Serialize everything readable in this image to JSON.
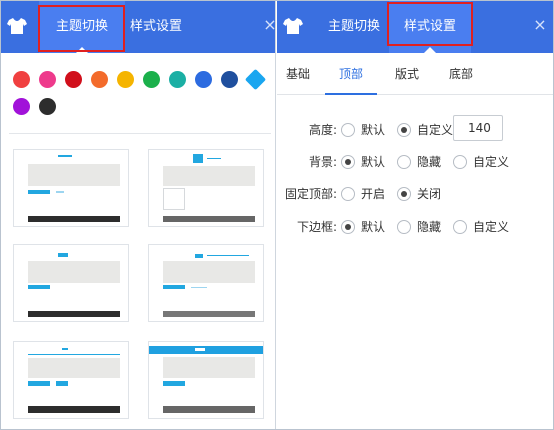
{
  "left_panel": {
    "tabs": [
      {
        "label": "主题切换",
        "active": true
      },
      {
        "label": "样式设置",
        "active": false
      }
    ],
    "close_symbol": "×",
    "color_swatches": [
      "#f04040",
      "#ee3a8c",
      "#d10f1b",
      "#f36b2b",
      "#f5b400",
      "#1bb04b",
      "#1bafa4",
      "#2c6be0",
      "#1f4f9e",
      "#1aa6f0",
      "#a112d9",
      "#2d2d2d"
    ],
    "theme_thumbnails": 6
  },
  "right_panel": {
    "tabs": [
      {
        "label": "主题切换",
        "active": false
      },
      {
        "label": "样式设置",
        "active": true
      }
    ],
    "close_symbol": "×",
    "subtabs": [
      {
        "label": "基础",
        "active": false
      },
      {
        "label": "顶部",
        "active": true
      },
      {
        "label": "版式",
        "active": false
      },
      {
        "label": "底部",
        "active": false
      }
    ],
    "settings": {
      "height": {
        "label": "高度:",
        "options": [
          "默认",
          "自定义"
        ],
        "selected": "自定义",
        "value": "140"
      },
      "background": {
        "label": "背景:",
        "options": [
          "默认",
          "隐藏",
          "自定义"
        ],
        "selected": "默认"
      },
      "fixed_top": {
        "label": "固定顶部:",
        "options": [
          "开启",
          "关闭"
        ],
        "selected": "关闭"
      },
      "bottom_border": {
        "label": "下边框:",
        "options": [
          "默认",
          "隐藏",
          "自定义"
        ],
        "selected": "默认"
      }
    }
  },
  "colors": {
    "header_blue": "#3a6fe0",
    "active_tab_blue": "#4a7ef0",
    "accent_blue": "#2d6fe0",
    "highlight_red": "#e02020"
  },
  "icons": {
    "app_icon": "tshirt-icon",
    "close_icon": "close-icon"
  }
}
